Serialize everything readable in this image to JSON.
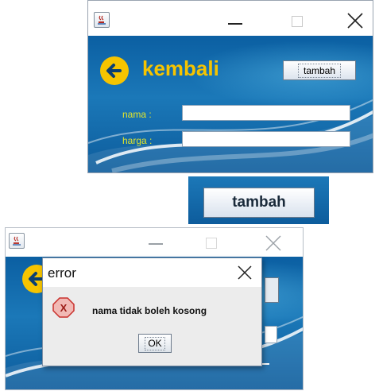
{
  "main_window": {
    "back_label": "kembali",
    "add_button_label": "tambah",
    "fields": [
      {
        "label": "nama :",
        "value": ""
      },
      {
        "label": "harga :",
        "value": ""
      }
    ]
  },
  "zoomed_button": {
    "label": "tambah"
  },
  "error_dialog": {
    "title": "error",
    "message": "nama tidak boleh kosong",
    "ok_label": "OK"
  },
  "colors": {
    "panel_blue": "#1b78b8",
    "label_yellow": "#e2e52b",
    "back_yellow": "#f6c400",
    "error_red": "#c9302c"
  }
}
